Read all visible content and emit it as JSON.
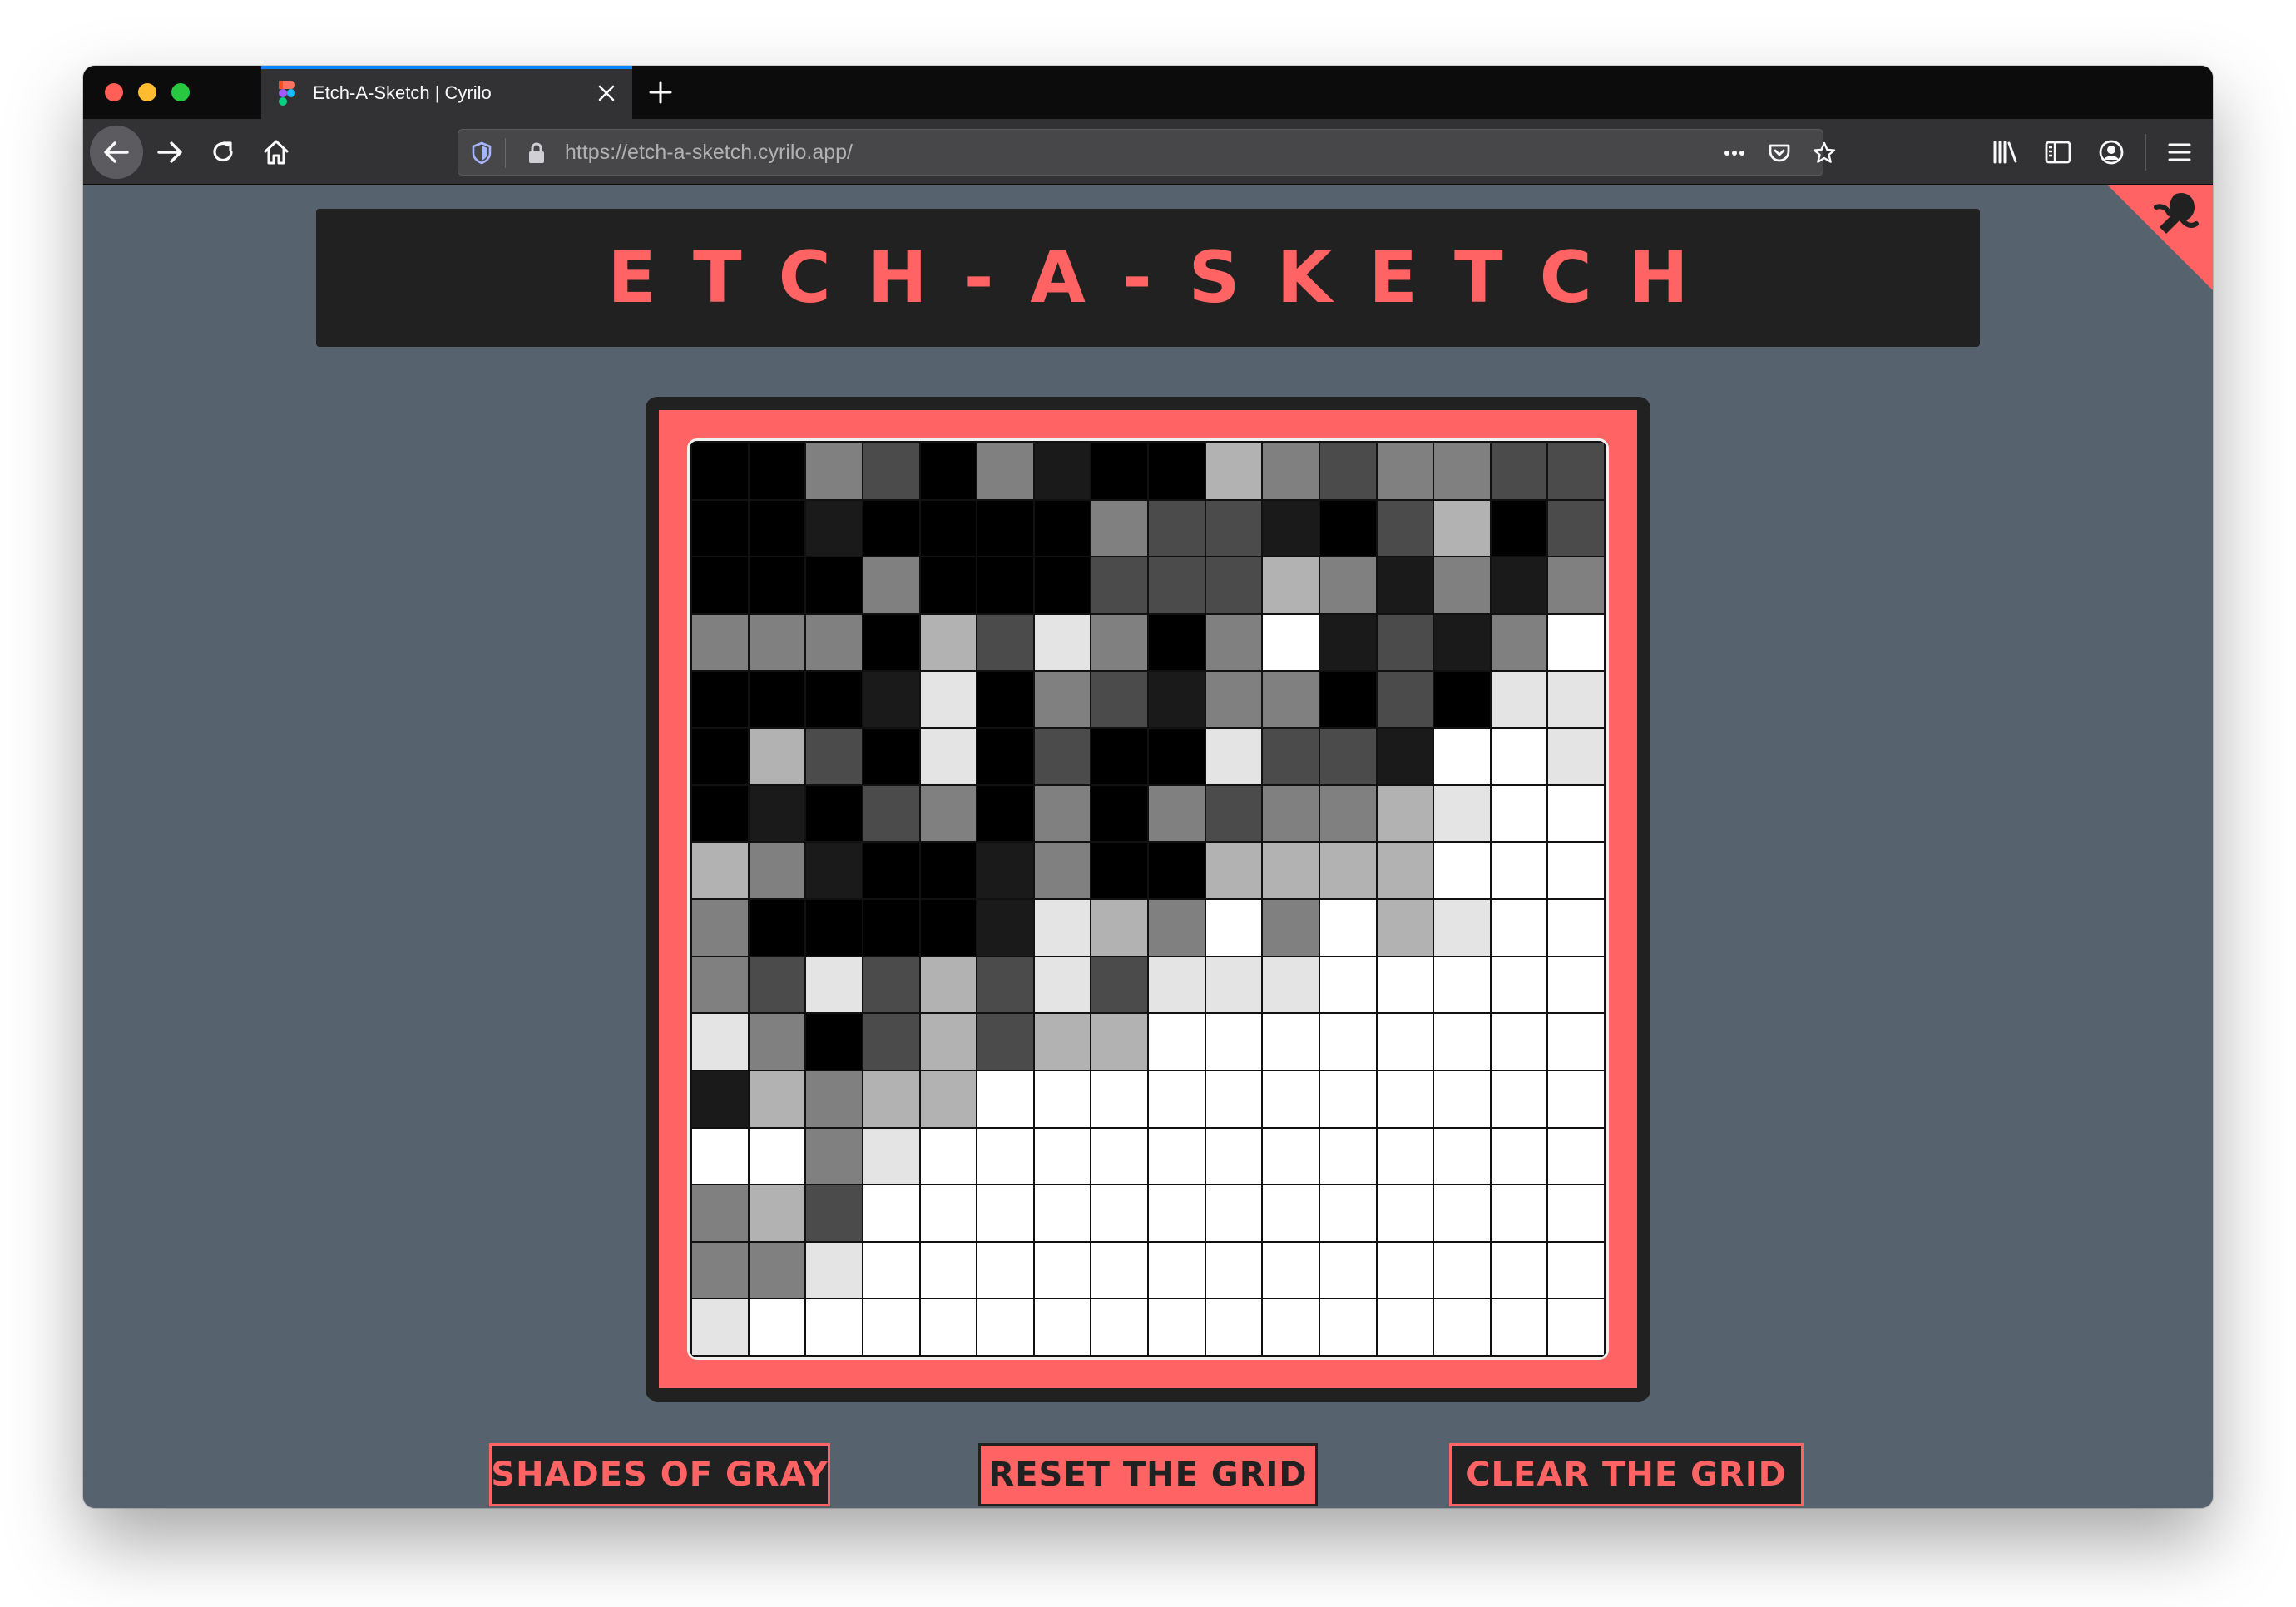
{
  "browser": {
    "tab_title": "Etch-A-Sketch | Cyrilo",
    "url": "https://etch-a-sketch.cyrilo.app/",
    "icons": [
      "close-icon",
      "new-tab-icon",
      "back-icon",
      "forward-icon",
      "reload-icon",
      "home-icon",
      "tracking-protection-icon",
      "lock-icon",
      "more-icon",
      "pocket-icon",
      "bookmark-star-icon",
      "library-icon",
      "sidebar-icon",
      "account-icon",
      "menu-icon"
    ],
    "colors": {
      "active_tab_accent": "#0a84ff",
      "traffic_red": "#ff5f57",
      "traffic_yellow": "#febc2e",
      "traffic_green": "#28c840"
    }
  },
  "page": {
    "title": "ETCH-A-SKETCH",
    "colors": {
      "accent": "#ff6363",
      "dark": "#212121",
      "background": "#56636f"
    },
    "buttons": {
      "shades": "SHADES OF GRAY",
      "reset": "RESET THE GRID",
      "clear": "CLEAR THE GRID"
    },
    "grid": {
      "size": 16,
      "palette": [
        "#ffffff",
        "#e4e4e4",
        "#b2b2b2",
        "#808080",
        "#4b4b4b",
        "#1a1a1a",
        "#000000"
      ],
      "cells": [
        [
          6,
          6,
          3,
          4,
          6,
          3,
          5,
          6,
          6,
          2,
          3,
          4,
          3,
          3,
          4,
          4
        ],
        [
          6,
          6,
          5,
          6,
          6,
          6,
          6,
          3,
          4,
          4,
          5,
          6,
          4,
          2,
          6,
          4
        ],
        [
          6,
          6,
          6,
          3,
          6,
          6,
          6,
          4,
          4,
          4,
          2,
          3,
          5,
          3,
          5,
          3
        ],
        [
          3,
          3,
          3,
          6,
          2,
          4,
          1,
          3,
          6,
          3,
          0,
          5,
          4,
          5,
          3,
          0
        ],
        [
          6,
          6,
          6,
          5,
          1,
          6,
          3,
          4,
          5,
          3,
          3,
          6,
          4,
          6,
          1,
          1
        ],
        [
          6,
          2,
          4,
          6,
          1,
          6,
          4,
          6,
          6,
          1,
          4,
          4,
          5,
          0,
          0,
          1
        ],
        [
          6,
          5,
          6,
          4,
          3,
          6,
          3,
          6,
          3,
          4,
          3,
          3,
          2,
          1,
          0,
          0
        ],
        [
          2,
          3,
          5,
          6,
          6,
          5,
          3,
          6,
          6,
          2,
          2,
          2,
          2,
          0,
          0,
          0
        ],
        [
          3,
          6,
          6,
          6,
          6,
          5,
          1,
          2,
          3,
          0,
          3,
          0,
          2,
          1,
          0,
          0
        ],
        [
          3,
          4,
          1,
          4,
          2,
          4,
          1,
          4,
          1,
          1,
          1,
          0,
          0,
          0,
          0,
          0
        ],
        [
          1,
          3,
          6,
          4,
          2,
          4,
          2,
          2,
          0,
          0,
          0,
          0,
          0,
          0,
          0,
          0
        ],
        [
          5,
          2,
          3,
          2,
          2,
          0,
          0,
          0,
          0,
          0,
          0,
          0,
          0,
          0,
          0,
          0
        ],
        [
          0,
          0,
          3,
          1,
          0,
          0,
          0,
          0,
          0,
          0,
          0,
          0,
          0,
          0,
          0,
          0
        ],
        [
          3,
          2,
          4,
          0,
          0,
          0,
          0,
          0,
          0,
          0,
          0,
          0,
          0,
          0,
          0,
          0
        ],
        [
          3,
          3,
          1,
          0,
          0,
          0,
          0,
          0,
          0,
          0,
          0,
          0,
          0,
          0,
          0,
          0
        ],
        [
          1,
          0,
          0,
          0,
          0,
          0,
          0,
          0,
          0,
          0,
          0,
          0,
          0,
          0,
          0,
          0
        ]
      ]
    }
  }
}
